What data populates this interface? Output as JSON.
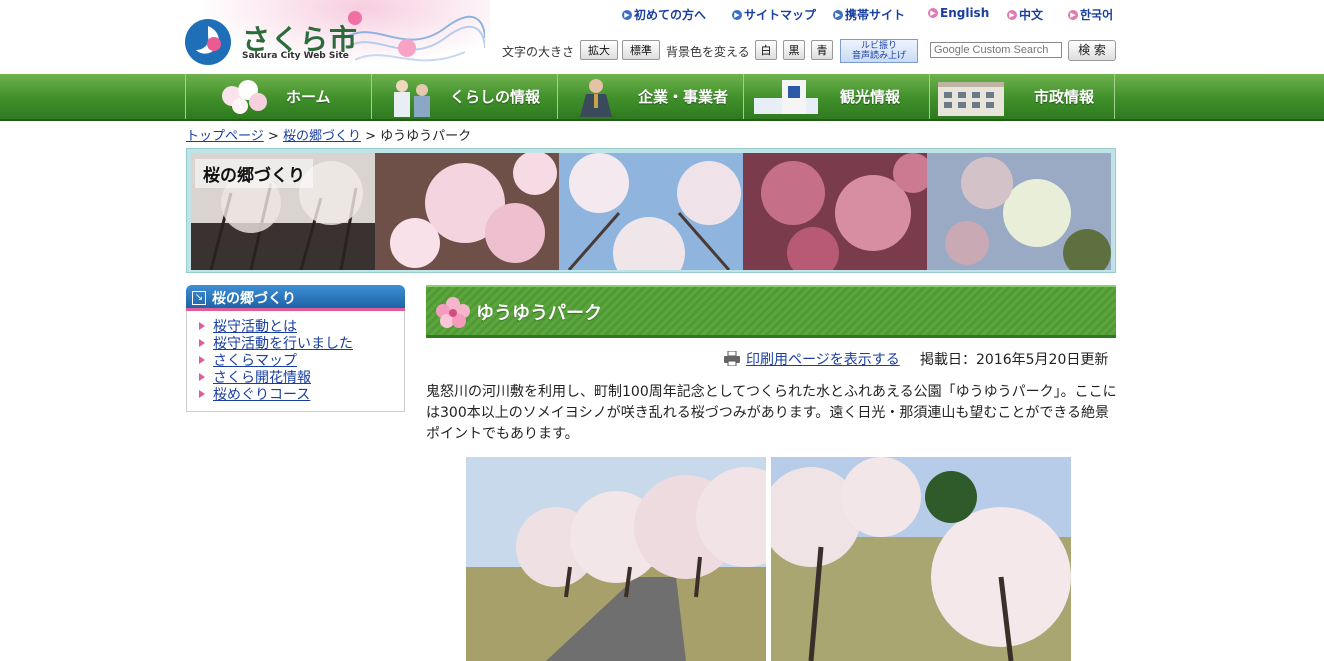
{
  "header": {
    "logo_title": "さくら市",
    "logo_subtitle": "Sakura City Web Site",
    "top_links": [
      {
        "label": "初めての方へ"
      },
      {
        "label": "サイトマップ"
      },
      {
        "label": "携帯サイト"
      },
      {
        "label": "English"
      },
      {
        "label": "中文"
      },
      {
        "label": "한국어"
      }
    ],
    "font_size_label": "文字の大きさ",
    "font_size_buttons": [
      "拡大",
      "標準"
    ],
    "bg_color_label": "背景色を変える",
    "bg_color_buttons": [
      "白",
      "黒",
      "青"
    ],
    "ruby_button_line1": "ルビ振り",
    "ruby_button_line2": "音声読み上げ",
    "search_placeholder": "Google Custom Search",
    "search_button": "検 索"
  },
  "nav": {
    "items": [
      {
        "label": "ホーム"
      },
      {
        "label": "くらしの情報"
      },
      {
        "label": "企業・事業者"
      },
      {
        "label": "観光情報"
      },
      {
        "label": "市政情報"
      }
    ]
  },
  "breadcrumb": {
    "items": [
      "トップページ",
      "桜の郷づくり"
    ],
    "separator": ">",
    "current": "ゆうゆうパーク"
  },
  "banner": {
    "title": "桜の郷づくり"
  },
  "sidebar": {
    "heading": "桜の郷づくり",
    "items": [
      {
        "label": "桜守活動とは"
      },
      {
        "label": "桜守活動を行いました"
      },
      {
        "label": "さくらマップ"
      },
      {
        "label": "さくら開花情報"
      },
      {
        "label": "桜めぐりコース"
      }
    ]
  },
  "main": {
    "title": "ゆうゆうパーク",
    "print_link": "印刷用ページを表示する",
    "updated": "掲載日：2016年5月20日更新",
    "description": "鬼怒川の河川敷を利用し、町制100周年記念としてつくられた水とふれあえる公園「ゆうゆうパーク」。ここには300本以上のソメイヨシノが咲き乱れる桜づつみがあります。遠く日光・那須連山も望むことができる絶景ポイントでもあります。"
  },
  "colors": {
    "nav_green": "#3f8f2a",
    "link_blue": "#1a3fa0",
    "sidebar_blue": "#1e63a8",
    "accent_pink": "#e05c9a"
  }
}
